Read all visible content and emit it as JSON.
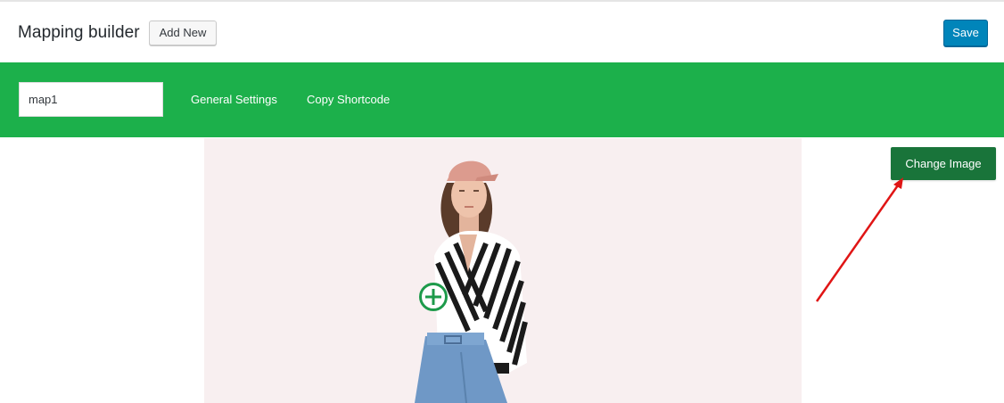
{
  "header": {
    "title": "Mapping builder",
    "add_new_label": "Add New",
    "save_label": "Save"
  },
  "toolbar": {
    "map_name_value": "map1",
    "general_settings_label": "General Settings",
    "copy_shortcode_label": "Copy Shortcode"
  },
  "canvas": {
    "change_image_label": "Change Image",
    "hotspot_icon": "plus-circle-icon",
    "arrow_icon": "red-arrow-annotation"
  },
  "colors": {
    "toolbar_bg": "#1cb04b",
    "save_bg": "#0085ba",
    "change_image_bg": "#19743a",
    "canvas_bg": "#f8eff0",
    "hotspot": "#1d9a4a",
    "arrow": "#e01515"
  }
}
